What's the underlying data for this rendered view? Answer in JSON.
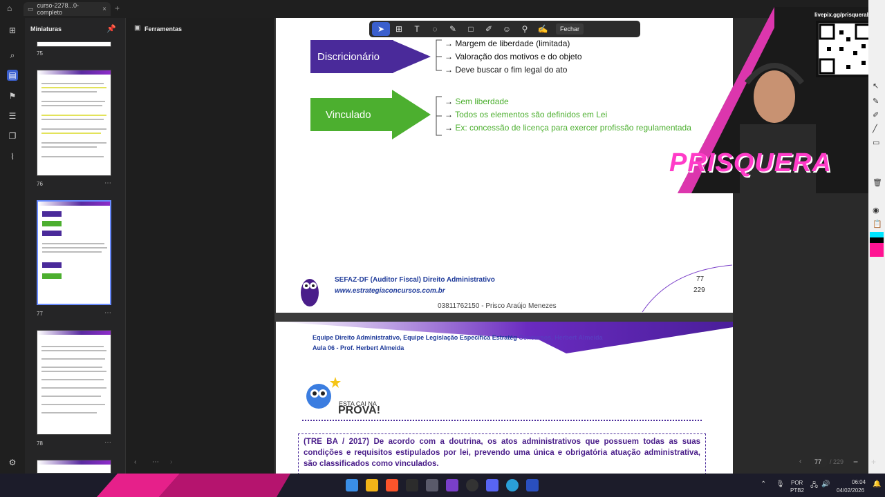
{
  "app": {
    "tab_title": "curso-2278...0-completo",
    "tab_close": "×",
    "new_tab": "+"
  },
  "thumbnails": {
    "header": "Miniaturas",
    "pages": [
      {
        "num": "75"
      },
      {
        "num": "76"
      },
      {
        "num": "77"
      },
      {
        "num": "78"
      }
    ],
    "more": "⋯"
  },
  "tools_panel": {
    "header": "Ferramentas"
  },
  "annot_toolbar": {
    "close_label": "Fechar"
  },
  "page77": {
    "discricionario": {
      "label": "Discricionário",
      "items": [
        "Margem de liberdade (limitada)",
        "Valoração dos motivos e do objeto",
        "Deve buscar o fim legal do ato"
      ]
    },
    "vinculado": {
      "label": "Vinculado",
      "items": [
        "Sem liberdade",
        "Todos os elementos são definidos em Lei",
        "Ex: concessão de licença para exercer profissão regulamentada"
      ]
    },
    "footer_course": "SEFAZ-DF (Auditor Fiscal) Direito Administrativo",
    "footer_site": "www.estrategiaconcursos.com.br",
    "page_num": "77",
    "page_total": "229",
    "watermark": "03811762150 - Prisco Araújo Menezes"
  },
  "page78": {
    "header_line1": "Equipe Direito Administrativo, Equipe Legislação Específica Estratég",
    "header_line1_faded": "Concursos, Herbert Almeida",
    "header_line2": "Aula 06 - Prof. Herbert Almeida",
    "badge_small": "ESTA CAI NA",
    "badge_big": "PROVA!",
    "question": "(TRE BA / 2017) De acordo com a doutrina, os atos administrativos que possuem todas as suas condições e requisitos estipulados por lei, prevendo uma única e obrigatória atuação administrativa, são classificados como vinculados."
  },
  "stream_overlay": {
    "livepix": "livepix.gg/prisquerabr",
    "brand": "PRISQUERA"
  },
  "page_nav": {
    "current": "77",
    "total": "/ 229"
  },
  "taskbar": {
    "lang1": "POR",
    "lang2": "PTB2",
    "time": "06:04",
    "date": "04/02/2026"
  },
  "colors": {
    "discricionario": "#4a2a9a",
    "vinculado": "#4caf2f",
    "accent": "#3a5fcd",
    "link_blue": "#1f3b9a",
    "brand_pink": "#ff3cc8"
  }
}
